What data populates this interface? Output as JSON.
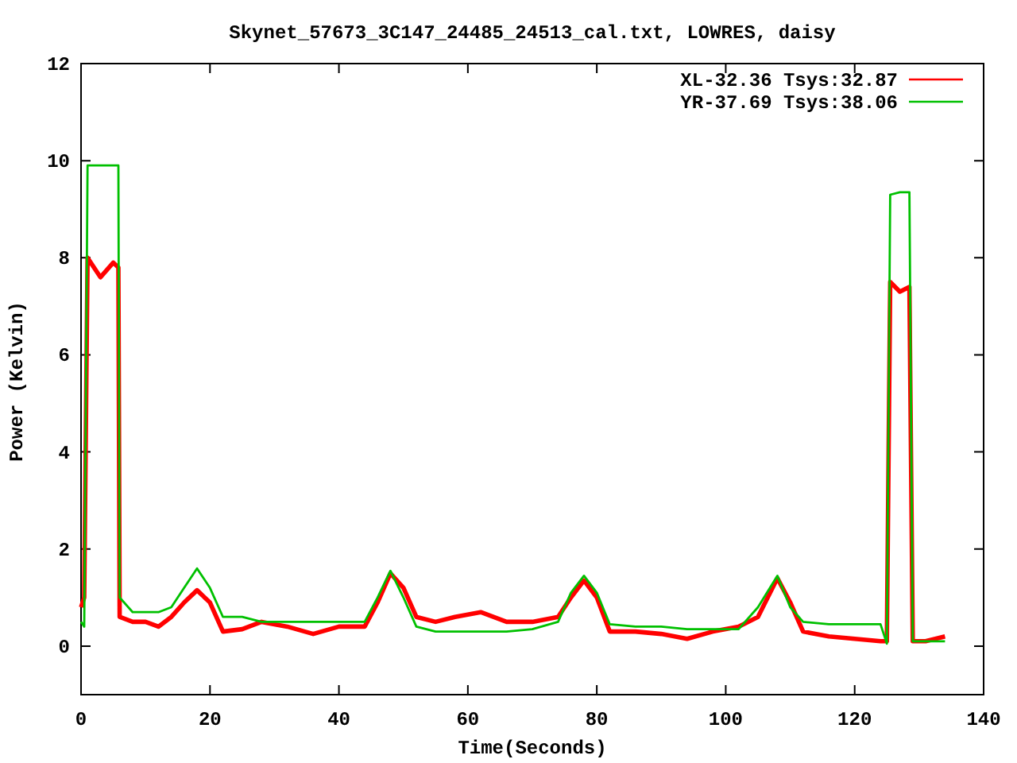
{
  "chart_data": {
    "type": "line",
    "title": "Skynet_57673_3C147_24485_24513_cal.txt, LOWRES, daisy",
    "xlabel": "Time(Seconds)",
    "ylabel": "Power (Kelvin)",
    "x": [
      0,
      0.5,
      1,
      3,
      5,
      5.8,
      6,
      8,
      10,
      12,
      14,
      16,
      18,
      20,
      22,
      25,
      28,
      32,
      36,
      40,
      44,
      46,
      48,
      50,
      52,
      55,
      58,
      62,
      66,
      70,
      74,
      76,
      78,
      80,
      82,
      86,
      90,
      94,
      98,
      102,
      105,
      108,
      110,
      112,
      116,
      120,
      124,
      125,
      125.5,
      127,
      128.5,
      129,
      131,
      134
    ],
    "series": [
      {
        "name": "XL-32.36 Tsys:32.87",
        "color": "#ff0000",
        "values": [
          0.8,
          1.0,
          8.0,
          7.6,
          7.9,
          7.8,
          0.6,
          0.5,
          0.5,
          0.4,
          0.6,
          0.9,
          1.15,
          0.9,
          0.3,
          0.35,
          0.5,
          0.4,
          0.25,
          0.4,
          0.4,
          0.9,
          1.5,
          1.2,
          0.6,
          0.5,
          0.6,
          0.7,
          0.5,
          0.5,
          0.6,
          1.0,
          1.35,
          1.0,
          0.3,
          0.3,
          0.25,
          0.15,
          0.3,
          0.4,
          0.6,
          1.4,
          0.9,
          0.3,
          0.2,
          0.15,
          0.1,
          0.1,
          7.5,
          7.3,
          7.4,
          0.1,
          0.1,
          0.2
        ]
      },
      {
        "name": "YR-37.69 Tsys:38.06",
        "color": "#00c000",
        "values": [
          0.5,
          0.4,
          9.9,
          9.9,
          9.9,
          9.9,
          1.0,
          0.7,
          0.7,
          0.7,
          0.8,
          1.2,
          1.6,
          1.2,
          0.6,
          0.6,
          0.5,
          0.5,
          0.5,
          0.5,
          0.5,
          1.0,
          1.55,
          1.0,
          0.4,
          0.3,
          0.3,
          0.3,
          0.3,
          0.35,
          0.5,
          1.1,
          1.45,
          1.1,
          0.45,
          0.4,
          0.4,
          0.35,
          0.35,
          0.35,
          0.8,
          1.45,
          0.8,
          0.5,
          0.45,
          0.45,
          0.45,
          0.05,
          9.3,
          9.35,
          9.35,
          0.1,
          0.1,
          0.1
        ]
      }
    ],
    "legend": true,
    "xlim": [
      0,
      140
    ],
    "ylim": [
      -1,
      12
    ],
    "xticks": [
      0,
      20,
      40,
      60,
      80,
      100,
      120,
      140
    ],
    "yticks": [
      0,
      2,
      4,
      6,
      8,
      10,
      12
    ]
  }
}
